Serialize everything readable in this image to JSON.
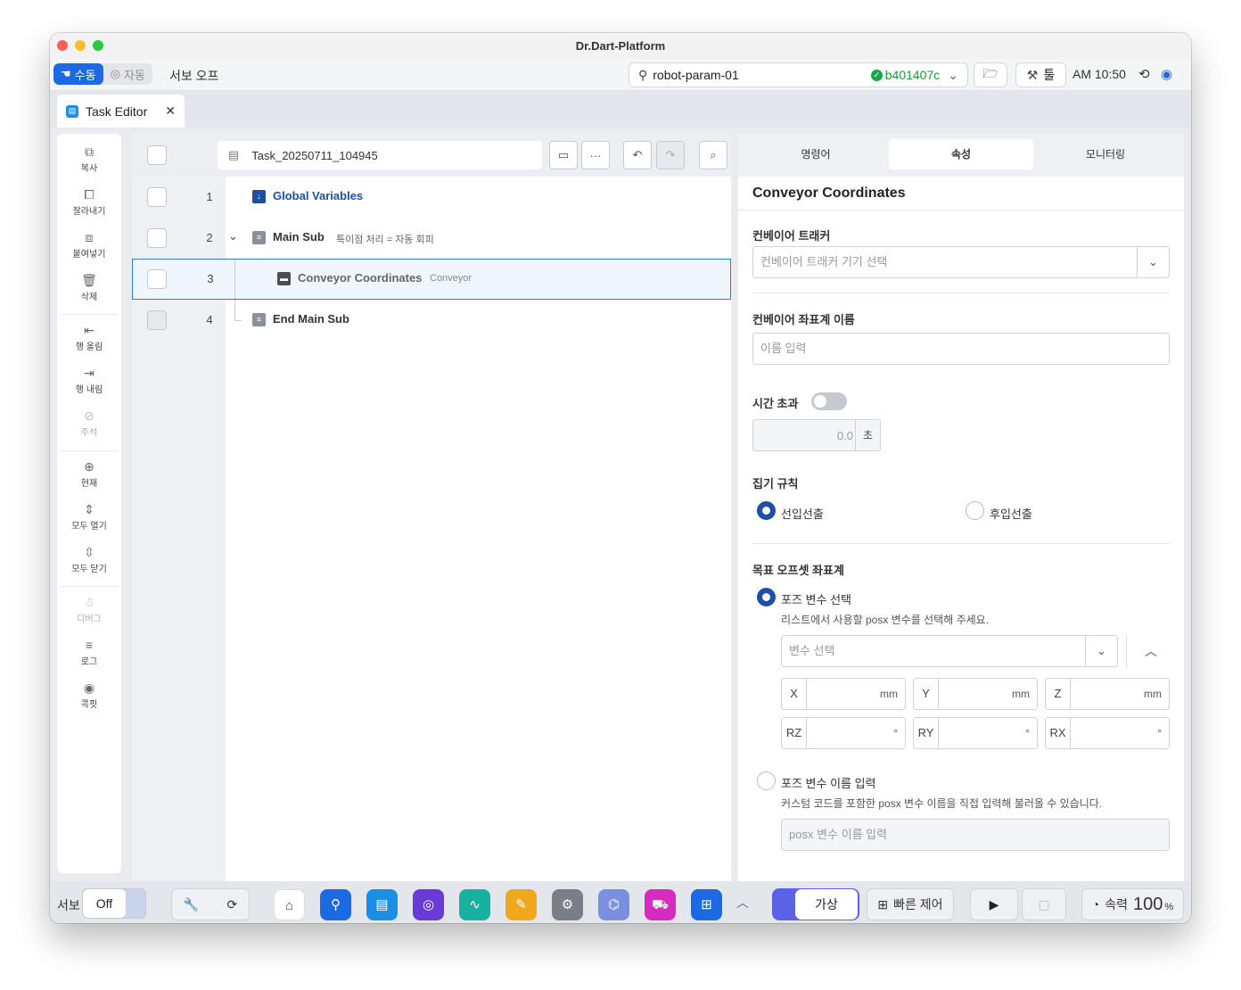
{
  "window": {
    "title": "Dr.Dart-Platform"
  },
  "topbar": {
    "mode_manual": "수동",
    "mode_auto": "자동",
    "servo_state": "서보 오프",
    "robot_name": "robot-param-01",
    "robot_version": "b401407c",
    "tool_label": "툴",
    "clock": "AM 10:50"
  },
  "tab": {
    "label": "Task Editor"
  },
  "sidebar": {
    "items": [
      {
        "label": "복사",
        "icon": "copy-icon"
      },
      {
        "label": "잘라내기",
        "icon": "cut-icon"
      },
      {
        "label": "붙여넣기",
        "icon": "paste-icon"
      },
      {
        "label": "삭제",
        "icon": "trash-icon"
      },
      {
        "label": "행 올림",
        "icon": "indent-icon"
      },
      {
        "label": "행 내림",
        "icon": "outdent-icon"
      },
      {
        "label": "주석",
        "icon": "comment-disabled-icon"
      },
      {
        "label": "현재",
        "icon": "target-icon"
      },
      {
        "label": "모두 열기",
        "icon": "expand-all-icon"
      },
      {
        "label": "모두 닫기",
        "icon": "collapse-all-icon"
      },
      {
        "label": "디버그",
        "icon": "debug-icon"
      },
      {
        "label": "로그",
        "icon": "log-icon"
      },
      {
        "label": "콕핏",
        "icon": "cockpit-icon"
      }
    ]
  },
  "editor": {
    "file_name": "Task_20250711_104945",
    "rows": [
      {
        "num": "1",
        "label": "Global Variables",
        "sub": ""
      },
      {
        "num": "2",
        "label": "Main Sub",
        "sub": "특이점 처리 = 자동 회피"
      },
      {
        "num": "3",
        "label": "Conveyor Coordinates",
        "sub": "Conveyor"
      },
      {
        "num": "4",
        "label": "End Main Sub",
        "sub": ""
      }
    ]
  },
  "panel": {
    "tabs": [
      "명령어",
      "속성",
      "모니터링"
    ],
    "active_tab": "속성",
    "title": "Conveyor Coordinates",
    "tracker_label": "컨베이어 트래커",
    "tracker_placeholder": "컨베이어 트래커 기기 선택",
    "coord_name_label": "컨베이어 좌표계 이름",
    "coord_name_placeholder": "이름 입력",
    "timeout_label": "시간 초과",
    "timeout_value": "0.0",
    "timeout_unit": "초",
    "pick_rule_label": "집기 규칙",
    "pick_fifo": "선입선출",
    "pick_lifo": "후입선출",
    "target_offset_label": "목표 오프셋 좌표계",
    "pose_var_select": "포즈 변수 선택",
    "pose_var_select_help": "리스트에서 사용할 posx 변수를 선택해 주세요.",
    "var_select_placeholder": "변수 선택",
    "coords": [
      {
        "key": "X",
        "unit": "mm"
      },
      {
        "key": "Y",
        "unit": "mm"
      },
      {
        "key": "Z",
        "unit": "mm"
      },
      {
        "key": "RZ",
        "unit": "°"
      },
      {
        "key": "RY",
        "unit": "°"
      },
      {
        "key": "RX",
        "unit": "°"
      }
    ],
    "pose_var_input": "포즈 변수 이름 입력",
    "pose_var_input_help": "커스텀 코드를 포함한 posx 변수 이름을 직접 입력해 불러올 수 있습니다.",
    "pose_var_input_placeholder": "posx 변수 이름 입력"
  },
  "bottombar": {
    "servo_label": "서보",
    "servo_value": "Off",
    "mode_value": "가상",
    "quick_control": "빠른 제어",
    "speed_label": "속력",
    "speed_value": "100",
    "speed_unit": "%"
  },
  "colors": {
    "accent": "#1b6ae3",
    "selected_border": "#2d7fd3",
    "radio_on": "#1b4fa8",
    "ok": "#18a84b"
  }
}
